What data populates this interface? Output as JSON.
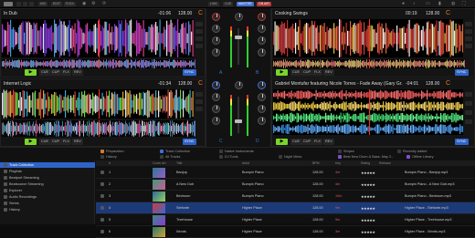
{
  "topbar": {
    "left_pills": [
      "MIX",
      "EDIT",
      "FLEX"
    ],
    "center_pills": [
      "LINK",
      "CUE",
      "MASTER",
      "ON AIR"
    ]
  },
  "decks": {
    "a": {
      "title": "In Dub",
      "time": "-01:06",
      "bpm": "128.00",
      "key": "C"
    },
    "b": {
      "title": "Cooking Swings",
      "time": "00:19",
      "bpm": "128.00",
      "key": "C"
    },
    "c": {
      "title": "Internet Logic",
      "time": "-01:34",
      "bpm": "128.00",
      "key": "C"
    },
    "d": {
      "title": "Gabriel Montufar featuring Nicole Torres - Fade Away (Gary Gr...",
      "time": "-04:01",
      "bpm": "128.00",
      "key": "C"
    }
  },
  "deck_controls": {
    "play": "▶",
    "cue": "CUE",
    "cup": "CUP",
    "flx": "FLX",
    "rev": "REV",
    "sync": "SYNC"
  },
  "mixer": {
    "labels": [
      "A",
      "B",
      "C",
      "D"
    ]
  },
  "favorites": {
    "row1": [
      "Preparation",
      "Track Collection",
      "Native Instruments",
      "Stripes",
      "Recently added"
    ],
    "row2": [
      "History",
      "All Tracks",
      "DJ Tools",
      "Night Vibes",
      "Best New Drum & Bass: May 2...",
      "Offline Library"
    ]
  },
  "tree": {
    "items": [
      {
        "label": "Track Collection",
        "selected": true
      },
      {
        "label": "Playlists",
        "selected": false
      },
      {
        "label": "Beatport Streaming",
        "selected": false
      },
      {
        "label": "Beatsource Streaming",
        "selected": false
      },
      {
        "label": "Explorer",
        "selected": false
      },
      {
        "label": "Audio Recordings",
        "selected": false
      },
      {
        "label": "Stems",
        "selected": false
      },
      {
        "label": "History",
        "selected": false
      }
    ]
  },
  "table": {
    "headers": [
      "#",
      "Cover Art",
      "Title",
      "Artist",
      "BPM",
      "Key",
      "Rating",
      "Release"
    ],
    "rows": [
      {
        "num": "1",
        "title": "Banjup",
        "artist": "Bumpin Piano",
        "bpm": "128.00",
        "key": "4m",
        "rating": "★★★★★",
        "release": "Bumpin Piano - Banjup.mp3",
        "selected": false
      },
      {
        "num": "2",
        "title": "A New Gob",
        "artist": "Bumpin Piano",
        "bpm": "128.00",
        "key": "4m",
        "rating": "★★★★★",
        "release": "Bumpin Piano - A New Gob.mp3",
        "selected": false
      },
      {
        "num": "3",
        "title": "Bedroom",
        "artist": "Bumpin Piano",
        "bpm": "128.00",
        "key": "10m",
        "rating": "★★★★★",
        "release": "Bumpin Piano - Bedroom.mp3",
        "selected": false
      },
      {
        "num": "4",
        "title": "Stefonte",
        "artist": "Higher Place",
        "bpm": "128.00",
        "key": "9m",
        "rating": "★★★★★",
        "release": "Higher Place - Stefonte.mp3",
        "selected": true
      },
      {
        "num": "5",
        "title": "Treehouse",
        "artist": "Higher Place",
        "bpm": "128.00",
        "key": "9m",
        "rating": "★★★★★",
        "release": "Higher Place - Treehouse.mp3",
        "selected": false
      },
      {
        "num": "6",
        "title": "Words",
        "artist": "Higher Place",
        "bpm": "128.00",
        "key": "3m",
        "rating": "★★★★★",
        "release": "Higher Place - Words.mp3",
        "selected": false
      }
    ]
  },
  "colors": {
    "accent": "#3d6fd6",
    "play": "#7bd42a",
    "key_orange": "#e07a2a",
    "selection": "#2e63c8"
  }
}
